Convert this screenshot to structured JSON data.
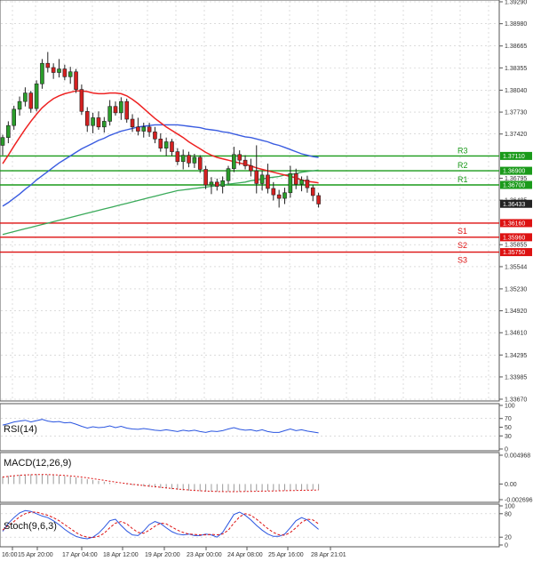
{
  "chart_data": [
    {
      "type": "candlestick",
      "title": "",
      "ylim": [
        1.3367,
        1.3929
      ],
      "y_ticks": [
        "1.39290",
        "1.38980",
        "1.38665",
        "1.38355",
        "1.38040",
        "1.37730",
        "1.37420",
        "1.36795",
        "1.36485",
        "1.35855",
        "1.35544",
        "1.35230",
        "1.34920",
        "1.34610",
        "1.34295",
        "1.33985",
        "1.33670"
      ],
      "x_ticks": [
        "16:00",
        "15 Apr 20:00",
        "17 Apr 04:00",
        "18 Apr 12:00",
        "19 Apr 20:00",
        "23 Apr 00:00",
        "24 Apr 08:00",
        "25 Apr 16:00",
        "28 Apr 21:01"
      ],
      "levels": [
        {
          "label": "R3",
          "value": 1.3711,
          "value_text": "1.37110",
          "color": "#1a9a1a"
        },
        {
          "label": "R2",
          "value": 1.369,
          "value_text": "1.36900",
          "color": "#1a9a1a"
        },
        {
          "label": "R1",
          "value": 1.367,
          "value_text": "1.36700",
          "color": "#1a9a1a"
        },
        {
          "label": "S1",
          "value": 1.3616,
          "value_text": "1.36160",
          "color": "#dd1111"
        },
        {
          "label": "S2",
          "value": 1.3596,
          "value_text": "1.35960",
          "color": "#dd1111"
        },
        {
          "label": "S3",
          "value": 1.3575,
          "value_text": "1.35750",
          "color": "#dd1111"
        }
      ],
      "last_price": {
        "value": 1.36433,
        "value_text": "1.36433"
      },
      "candles": [
        [
          1.3726,
          1.3741,
          1.3712,
          1.3737
        ],
        [
          1.3737,
          1.376,
          1.3729,
          1.3754
        ],
        [
          1.3754,
          1.3782,
          1.3748,
          1.3777
        ],
        [
          1.3777,
          1.3795,
          1.3768,
          1.3788
        ],
        [
          1.3788,
          1.3808,
          1.3781,
          1.38
        ],
        [
          1.38,
          1.3803,
          1.3772,
          1.3778
        ],
        [
          1.3778,
          1.3818,
          1.3774,
          1.3813
        ],
        [
          1.3813,
          1.3848,
          1.3806,
          1.3842
        ],
        [
          1.3842,
          1.3858,
          1.3829,
          1.3836
        ],
        [
          1.3836,
          1.3842,
          1.382,
          1.3829
        ],
        [
          1.3829,
          1.3848,
          1.3822,
          1.3834
        ],
        [
          1.3834,
          1.384,
          1.3818,
          1.3823
        ],
        [
          1.3823,
          1.3837,
          1.3813,
          1.383
        ],
        [
          1.383,
          1.3834,
          1.38,
          1.3805
        ],
        [
          1.3805,
          1.3812,
          1.3769,
          1.3774
        ],
        [
          1.3774,
          1.378,
          1.3745,
          1.3754
        ],
        [
          1.3754,
          1.3772,
          1.3743,
          1.3765
        ],
        [
          1.3765,
          1.3774,
          1.3748,
          1.3752
        ],
        [
          1.3752,
          1.3766,
          1.3744,
          1.376
        ],
        [
          1.376,
          1.379,
          1.3754,
          1.3781
        ],
        [
          1.3781,
          1.3788,
          1.3768,
          1.3772
        ],
        [
          1.3772,
          1.3794,
          1.3762,
          1.3788
        ],
        [
          1.3788,
          1.3792,
          1.3758,
          1.3763
        ],
        [
          1.3763,
          1.377,
          1.3745,
          1.3752
        ],
        [
          1.3752,
          1.3765,
          1.374,
          1.3746
        ],
        [
          1.3746,
          1.3758,
          1.3737,
          1.3752
        ],
        [
          1.3752,
          1.3758,
          1.3738,
          1.3745
        ],
        [
          1.3745,
          1.3752,
          1.3729,
          1.3735
        ],
        [
          1.3735,
          1.3743,
          1.3717,
          1.3722
        ],
        [
          1.3722,
          1.3737,
          1.3711,
          1.3731
        ],
        [
          1.3731,
          1.3735,
          1.3711,
          1.3717
        ],
        [
          1.3717,
          1.3722,
          1.3698,
          1.3703
        ],
        [
          1.3703,
          1.372,
          1.3692,
          1.3712
        ],
        [
          1.3712,
          1.3717,
          1.3695,
          1.3701
        ],
        [
          1.3701,
          1.3714,
          1.3694,
          1.3709
        ],
        [
          1.3709,
          1.3712,
          1.3687,
          1.3692
        ],
        [
          1.3692,
          1.3697,
          1.3664,
          1.367
        ],
        [
          1.367,
          1.3681,
          1.3657,
          1.3674
        ],
        [
          1.3674,
          1.3679,
          1.3662,
          1.3668
        ],
        [
          1.3668,
          1.3682,
          1.3658,
          1.3676
        ],
        [
          1.3676,
          1.3697,
          1.3671,
          1.3693
        ],
        [
          1.3693,
          1.3724,
          1.3688,
          1.3713
        ],
        [
          1.3713,
          1.3719,
          1.3698,
          1.3705
        ],
        [
          1.3705,
          1.3712,
          1.3692,
          1.3697
        ],
        [
          1.3697,
          1.3707,
          1.3682,
          1.369
        ],
        [
          1.369,
          1.3726,
          1.3658,
          1.3672
        ],
        [
          1.3672,
          1.369,
          1.3662,
          1.3684
        ],
        [
          1.3684,
          1.37,
          1.3658,
          1.3665
        ],
        [
          1.3665,
          1.3674,
          1.3648,
          1.3656
        ],
        [
          1.3656,
          1.3663,
          1.3638,
          1.3651
        ],
        [
          1.3651,
          1.3666,
          1.3643,
          1.3659
        ],
        [
          1.3659,
          1.3697,
          1.3652,
          1.3686
        ],
        [
          1.3686,
          1.3693,
          1.3664,
          1.3671
        ],
        [
          1.3671,
          1.3682,
          1.3661,
          1.3677
        ],
        [
          1.3677,
          1.3683,
          1.3659,
          1.3666
        ],
        [
          1.3666,
          1.367,
          1.3647,
          1.3655
        ],
        [
          1.3655,
          1.3659,
          1.3638,
          1.3643
        ]
      ],
      "ma_red": [
        1.37,
        1.3712,
        1.3725,
        1.3737,
        1.3749,
        1.376,
        1.377,
        1.3779,
        1.3786,
        1.3792,
        1.3796,
        1.3799,
        1.3801,
        1.3803,
        1.3803,
        1.3802,
        1.38,
        1.3799,
        1.3799,
        1.38,
        1.38,
        1.3799,
        1.3796,
        1.3791,
        1.3785,
        1.3778,
        1.3771,
        1.3764,
        1.3758,
        1.3752,
        1.3747,
        1.3742,
        1.3737,
        1.3731,
        1.3726,
        1.3721,
        1.3716,
        1.3712,
        1.3709,
        1.3707,
        1.3705,
        1.3703,
        1.3701,
        1.3699,
        1.3697,
        1.3694,
        1.3692,
        1.369,
        1.3688,
        1.3686,
        1.3684,
        1.3682,
        1.368,
        1.3677,
        1.3675,
        1.3674,
        1.3673
      ],
      "ma_blue": [
        1.364,
        1.3645,
        1.3651,
        1.3657,
        1.3664,
        1.367,
        1.3677,
        1.3683,
        1.3689,
        1.3695,
        1.3701,
        1.3706,
        1.3711,
        1.3716,
        1.3721,
        1.3725,
        1.3729,
        1.3733,
        1.3736,
        1.374,
        1.3743,
        1.3746,
        1.3748,
        1.375,
        1.3752,
        1.3753,
        1.3754,
        1.3755,
        1.3755,
        1.3755,
        1.3755,
        1.3755,
        1.3754,
        1.3753,
        1.3752,
        1.3751,
        1.3749,
        1.3748,
        1.3747,
        1.3745,
        1.3744,
        1.3742,
        1.374,
        1.3738,
        1.3737,
        1.3735,
        1.3733,
        1.3731,
        1.3728,
        1.3726,
        1.3723,
        1.372,
        1.3717,
        1.3714,
        1.3712,
        1.371,
        1.3709
      ],
      "ma_green": [
        1.36,
        1.3602,
        1.3604,
        1.3606,
        1.3608,
        1.361,
        1.3612,
        1.3614,
        1.3616,
        1.3618,
        1.362,
        1.3622,
        1.3624,
        1.3626,
        1.3628,
        1.363,
        1.3632,
        1.3634,
        1.3636,
        1.3638,
        1.364,
        1.3642,
        1.3644,
        1.3646,
        1.3648,
        1.365,
        1.3652,
        1.3654,
        1.3656,
        1.3658,
        1.366,
        1.3662,
        1.3663,
        1.3664,
        1.3665,
        1.3666,
        1.3667,
        1.3668,
        1.3669,
        1.367,
        1.3671,
        1.3672,
        1.3673,
        1.3674,
        1.3676,
        1.3677,
        1.3678,
        1.368,
        1.3681,
        1.3682,
        1.3684,
        1.3685,
        1.3686,
        1.3688,
        1.3689,
        1.369,
        1.3691
      ]
    },
    {
      "type": "line",
      "label": "RSI(14)",
      "ylim": [
        0,
        100
      ],
      "y_ticks": [
        "100",
        "70",
        "50",
        "30",
        "0"
      ],
      "values": [
        55,
        58,
        62,
        64,
        66,
        62,
        65,
        68,
        64,
        62,
        63,
        60,
        61,
        57,
        52,
        48,
        51,
        49,
        50,
        53,
        49,
        52,
        48,
        46,
        45,
        47,
        45,
        43,
        42,
        44,
        42,
        40,
        43,
        41,
        43,
        40,
        38,
        41,
        40,
        42,
        46,
        49,
        45,
        43,
        44,
        41,
        44,
        40,
        38,
        38,
        42,
        46,
        42,
        44,
        41,
        39,
        37
      ]
    },
    {
      "type": "bar",
      "label": "MACD(12,26,9)",
      "ylim": [
        -0.002696,
        0.004968
      ],
      "y_ticks": [
        "0.004968",
        "0.00",
        "-0.002696"
      ],
      "values": [
        0.0013,
        0.0014,
        0.0015,
        0.0016,
        0.00165,
        0.00168,
        0.0017,
        0.00168,
        0.00164,
        0.00158,
        0.0015,
        0.0014,
        0.00128,
        0.00115,
        0.001,
        0.00085,
        0.0007,
        0.00055,
        0.0004,
        0.00025,
        0.00012,
        0.0,
        -0.0001,
        -0.0002,
        -0.0003,
        -0.0004,
        -0.0005,
        -0.0006,
        -0.0007,
        -0.0008,
        -0.0009,
        -0.001,
        -0.0011,
        -0.00115,
        -0.0012,
        -0.00125,
        -0.0013,
        -0.00132,
        -0.00134,
        -0.00135,
        -0.00134,
        -0.00132,
        -0.0013,
        -0.00128,
        -0.00125,
        -0.00122,
        -0.0012,
        -0.00118,
        -0.00116,
        -0.00114,
        -0.00112,
        -0.0011,
        -0.00108,
        -0.00106,
        -0.00104,
        -0.00102,
        -0.001
      ],
      "signal": [
        0.0012,
        0.00132,
        0.00142,
        0.0015,
        0.00156,
        0.0016,
        0.00162,
        0.00163,
        0.00162,
        0.00159,
        0.00154,
        0.00148,
        0.0014,
        0.0013,
        0.00119,
        0.00106,
        0.00092,
        0.00078,
        0.00063,
        0.00048,
        0.00034,
        0.0002,
        8e-05,
        -4e-05,
        -0.00015,
        -0.00026,
        -0.00036,
        -0.00046,
        -0.00056,
        -0.00066,
        -0.00076,
        -0.00086,
        -0.00095,
        -0.00103,
        -0.0011,
        -0.00116,
        -0.00121,
        -0.00125,
        -0.00128,
        -0.0013,
        -0.00131,
        -0.00131,
        -0.0013,
        -0.00129,
        -0.00127,
        -0.00125,
        -0.00123,
        -0.00121,
        -0.00119,
        -0.00117,
        -0.00115,
        -0.00113,
        -0.00111,
        -0.00109,
        -0.00107,
        -0.00105,
        -0.00103
      ]
    },
    {
      "type": "line",
      "label": "Stoch(9,6,3)",
      "ylim": [
        0,
        100
      ],
      "y_ticks": [
        "100",
        "80",
        "20",
        "0"
      ],
      "k": [
        35,
        55,
        70,
        82,
        88,
        86,
        80,
        74,
        70,
        62,
        52,
        40,
        30,
        22,
        18,
        16,
        20,
        30,
        45,
        62,
        66,
        50,
        36,
        26,
        24,
        36,
        52,
        60,
        55,
        44,
        34,
        28,
        26,
        28,
        24,
        24,
        28,
        26,
        20,
        32,
        55,
        78,
        84,
        76,
        64,
        50,
        38,
        28,
        22,
        22,
        28,
        44,
        62,
        70,
        64,
        52,
        40
      ],
      "d": [
        38,
        50,
        60,
        72,
        80,
        84,
        84,
        80,
        76,
        70,
        62,
        52,
        42,
        32,
        24,
        20,
        19,
        22,
        30,
        44,
        56,
        60,
        54,
        42,
        32,
        30,
        38,
        48,
        56,
        54,
        46,
        38,
        32,
        28,
        27,
        26,
        26,
        27,
        26,
        28,
        38,
        56,
        72,
        80,
        76,
        66,
        54,
        42,
        32,
        26,
        25,
        32,
        44,
        58,
        66,
        64,
        54
      ]
    }
  ]
}
